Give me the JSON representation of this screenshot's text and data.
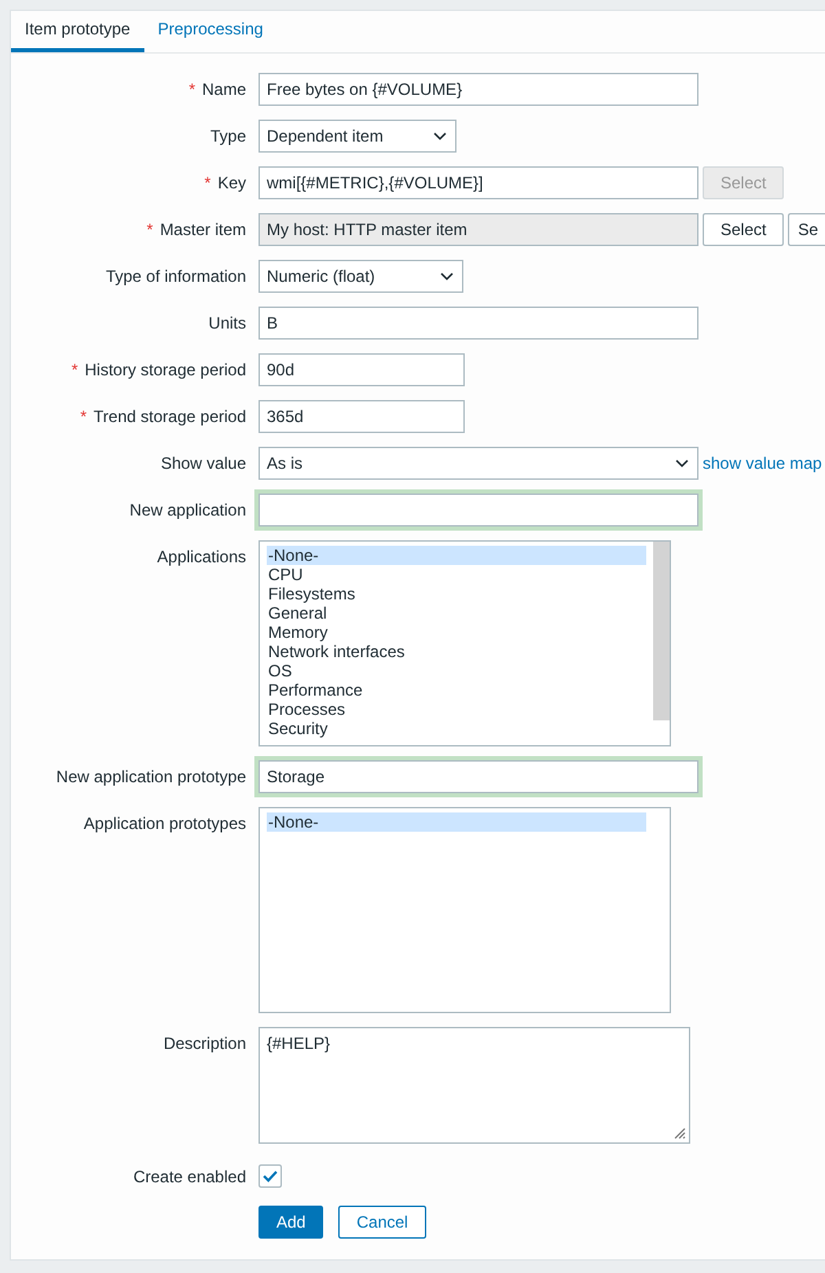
{
  "tabs": [
    {
      "label": "Item prototype",
      "selected": true
    },
    {
      "label": "Preprocessing",
      "selected": false
    }
  ],
  "fields": [
    {
      "kind": "text",
      "label": "Name",
      "required_mark": "*",
      "value": "Free bytes on {#VOLUME}"
    },
    {
      "kind": "select",
      "label": "Type",
      "value": "Dependent item"
    },
    {
      "kind": "text",
      "label": "Key",
      "required_mark": "*",
      "value": "wmi[{#METRIC},{#VOLUME}]",
      "buttons": [
        {
          "label": "Select",
          "disabled": true
        }
      ]
    },
    {
      "kind": "text",
      "label": "Master item",
      "required_mark": "*",
      "readonly": true,
      "value": "My host: HTTP master item",
      "buttons": [
        {
          "label": "Select",
          "disabled": false
        },
        {
          "label": "Se",
          "disabled": false
        }
      ]
    },
    {
      "kind": "select",
      "label": "Type of information",
      "value": "Numeric (float)"
    },
    {
      "kind": "text",
      "label": "Units",
      "value": "B"
    },
    {
      "kind": "text",
      "label": "History storage period",
      "required_mark": "*",
      "value": "90d"
    },
    {
      "kind": "text",
      "label": "Trend storage period",
      "required_mark": "*",
      "value": "365d"
    },
    {
      "kind": "select",
      "label": "Show value",
      "value": "As is",
      "link": "show value map"
    },
    {
      "kind": "text",
      "label": "New application",
      "highlighted": true
    },
    {
      "kind": "listbox",
      "label": "Applications",
      "scrollbar": true,
      "options": [
        {
          "label": "-None-",
          "selected": true
        },
        {
          "label": "CPU",
          "selected": false
        },
        {
          "label": "Filesystems",
          "selected": false
        },
        {
          "label": "General",
          "selected": false
        },
        {
          "label": "Memory",
          "selected": false
        },
        {
          "label": "Network interfaces",
          "selected": false
        },
        {
          "label": "OS",
          "selected": false
        },
        {
          "label": "Performance",
          "selected": false
        },
        {
          "label": "Processes",
          "selected": false
        },
        {
          "label": "Security",
          "selected": false
        }
      ]
    },
    {
      "kind": "text",
      "label": "New application prototype",
      "highlighted": true,
      "value": "Storage"
    },
    {
      "kind": "listbox",
      "label": "Application prototypes",
      "options": [
        {
          "label": "-None-",
          "selected": true
        }
      ]
    },
    {
      "kind": "textarea",
      "label": "Description",
      "value": "{#HELP}"
    },
    {
      "kind": "checkbox",
      "label": "Create enabled",
      "checked": true
    }
  ],
  "actions": [
    {
      "label": "Add",
      "primary": true
    },
    {
      "label": "Cancel",
      "primary": false
    }
  ]
}
